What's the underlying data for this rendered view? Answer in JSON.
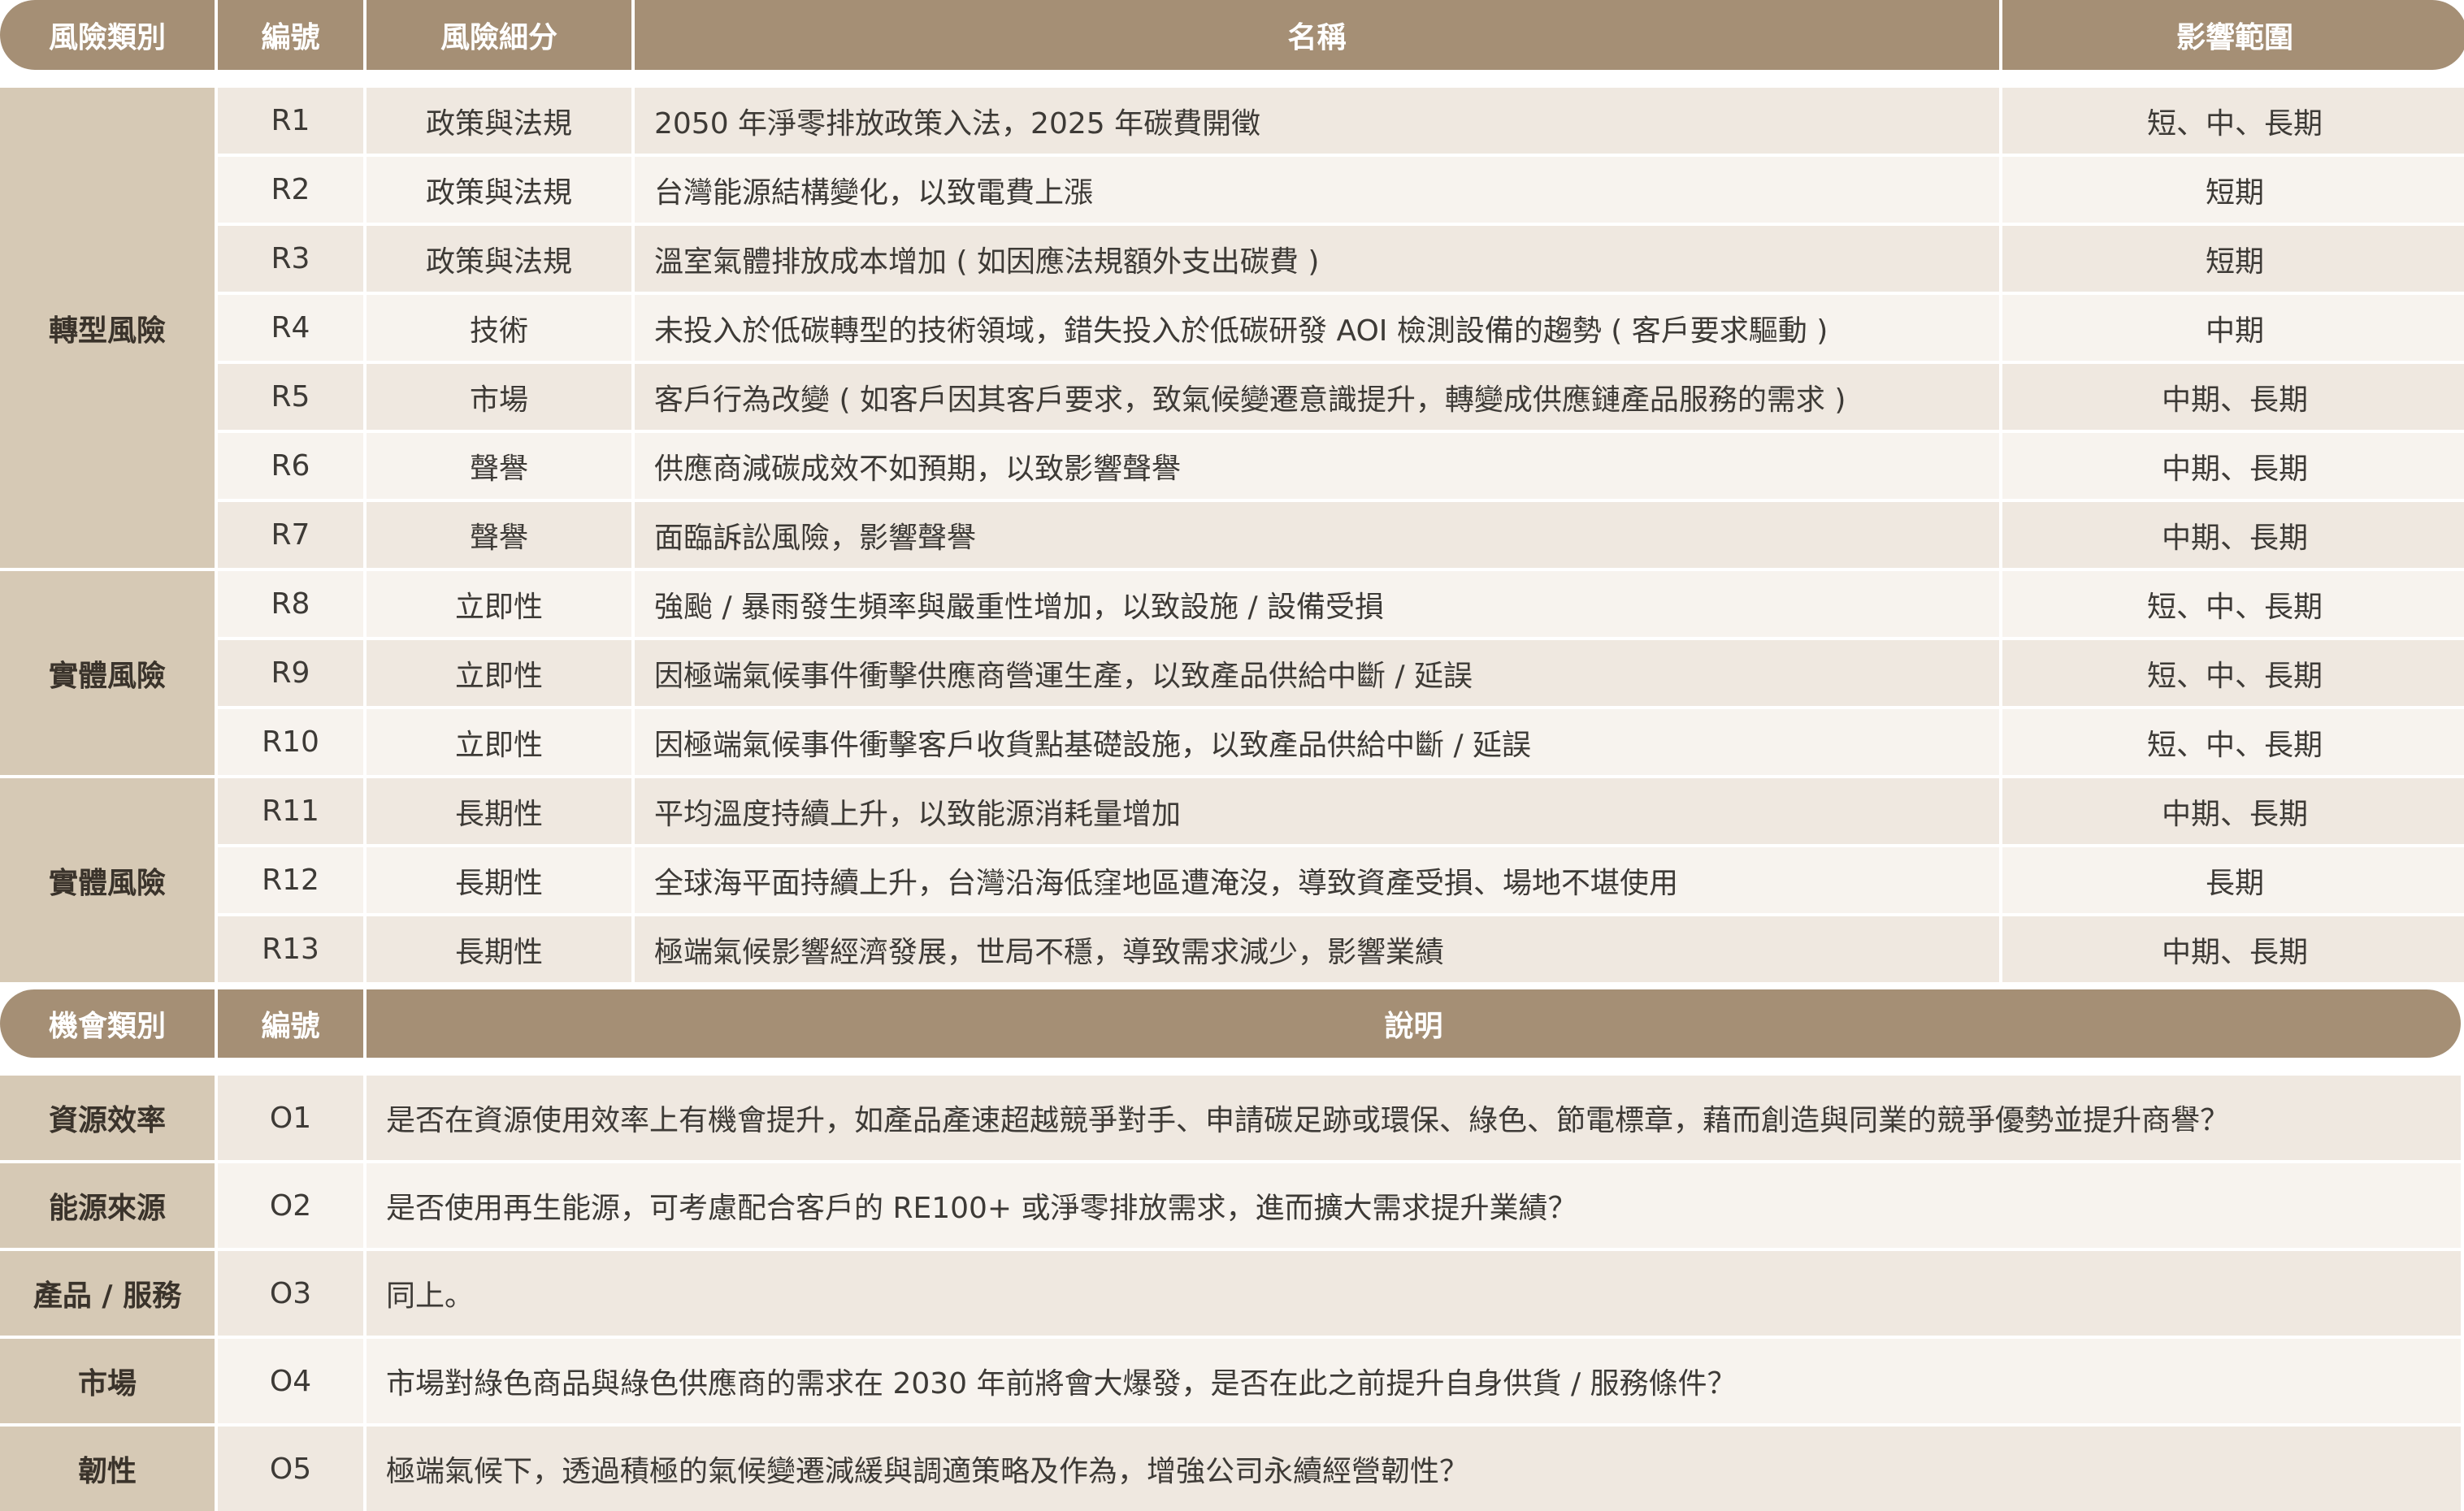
{
  "risk_table": {
    "headers": {
      "category": "風險類別",
      "id": "編號",
      "subcategory": "風險細分",
      "name": "名稱",
      "impact": "影響範圍"
    },
    "groups": [
      {
        "label": "轉型風險",
        "row_start": 3,
        "row_span": 7
      },
      {
        "label": "實體風險",
        "row_start": 10,
        "row_span": 3
      },
      {
        "label": "實體風險",
        "row_start": 13,
        "row_span": 3
      }
    ],
    "rows": [
      {
        "id": "R1",
        "subcategory": "政策與法規",
        "name": "2050 年淨零排放政策入法，2025 年碳費開徵",
        "impact": "短、中、長期"
      },
      {
        "id": "R2",
        "subcategory": "政策與法規",
        "name": "台灣能源結構變化，以致電費上漲",
        "impact": "短期"
      },
      {
        "id": "R3",
        "subcategory": "政策與法規",
        "name": "溫室氣體排放成本增加 ( 如因應法規額外支出碳費 )",
        "impact": "短期"
      },
      {
        "id": "R4",
        "subcategory": "技術",
        "name": "未投入於低碳轉型的技術領域，錯失投入於低碳研發 AOI 檢測設備的趨勢 ( 客戶要求驅動 )",
        "impact": "中期"
      },
      {
        "id": "R5",
        "subcategory": "市場",
        "name": "客戶行為改變 ( 如客戶因其客戶要求，致氣候變遷意識提升，轉變成供應鏈產品服務的需求 )",
        "impact": "中期、長期"
      },
      {
        "id": "R6",
        "subcategory": "聲譽",
        "name": "供應商減碳成效不如預期，以致影響聲譽",
        "impact": "中期、長期"
      },
      {
        "id": "R7",
        "subcategory": "聲譽",
        "name": "面臨訴訟風險，影響聲譽",
        "impact": "中期、長期"
      },
      {
        "id": "R8",
        "subcategory": "立即性",
        "name": "強颱 / 暴雨發生頻率與嚴重性增加，以致設施 / 設備受損",
        "impact": "短、中、長期"
      },
      {
        "id": "R9",
        "subcategory": "立即性",
        "name": "因極端氣候事件衝擊供應商營運生產，以致產品供給中斷 / 延誤",
        "impact": "短、中、長期"
      },
      {
        "id": "R10",
        "subcategory": "立即性",
        "name": "因極端氣候事件衝擊客戶收貨點基礎設施，以致產品供給中斷 / 延誤",
        "impact": "短、中、長期"
      },
      {
        "id": "R11",
        "subcategory": "長期性",
        "name": "平均溫度持續上升，以致能源消耗量增加",
        "impact": "中期、長期"
      },
      {
        "id": "R12",
        "subcategory": "長期性",
        "name": "全球海平面持續上升，台灣沿海低窪地區遭淹沒，導致資產受損、場地不堪使用",
        "impact": "長期"
      },
      {
        "id": "R13",
        "subcategory": "長期性",
        "name": "極端氣候影響經濟發展，世局不穩，導致需求減少，影響業績",
        "impact": "中期、長期"
      }
    ]
  },
  "opportunity_table": {
    "headers": {
      "category": "機會類別",
      "id": "編號",
      "description": "說明"
    },
    "rows": [
      {
        "category": "資源效率",
        "id": "O1",
        "description": "是否在資源使用效率上有機會提升，如產品產速超越競爭對手、申請碳足跡或環保、綠色、節電標章，藉而創造與同業的競爭優勢並提升商譽？"
      },
      {
        "category": "能源來源",
        "id": "O2",
        "description": "是否使用再生能源，可考慮配合客戶的 RE100+ 或淨零排放需求，進而擴大需求提升業績？"
      },
      {
        "category": "產品 / 服務",
        "id": "O3",
        "description": "同上。"
      },
      {
        "category": "市場",
        "id": "O4",
        "description": "市場對綠色商品與綠色供應商的需求在 2030 年前將會大爆發，是否在此之前提升自身供貨 / 服務條件？"
      },
      {
        "category": "韌性",
        "id": "O5",
        "description": "極端氣候下，透過積極的氣候變遷減緩與調適策略及作為，增強公司永續經營韌性？"
      }
    ]
  },
  "colors": {
    "header_bg": "#a58f75",
    "header_text": "#ffffff",
    "category_bg": "#d6c9b5",
    "row_odd_bg": "#efe8e0",
    "row_even_bg": "#f7f3ee",
    "body_text": "#3d3a36"
  }
}
